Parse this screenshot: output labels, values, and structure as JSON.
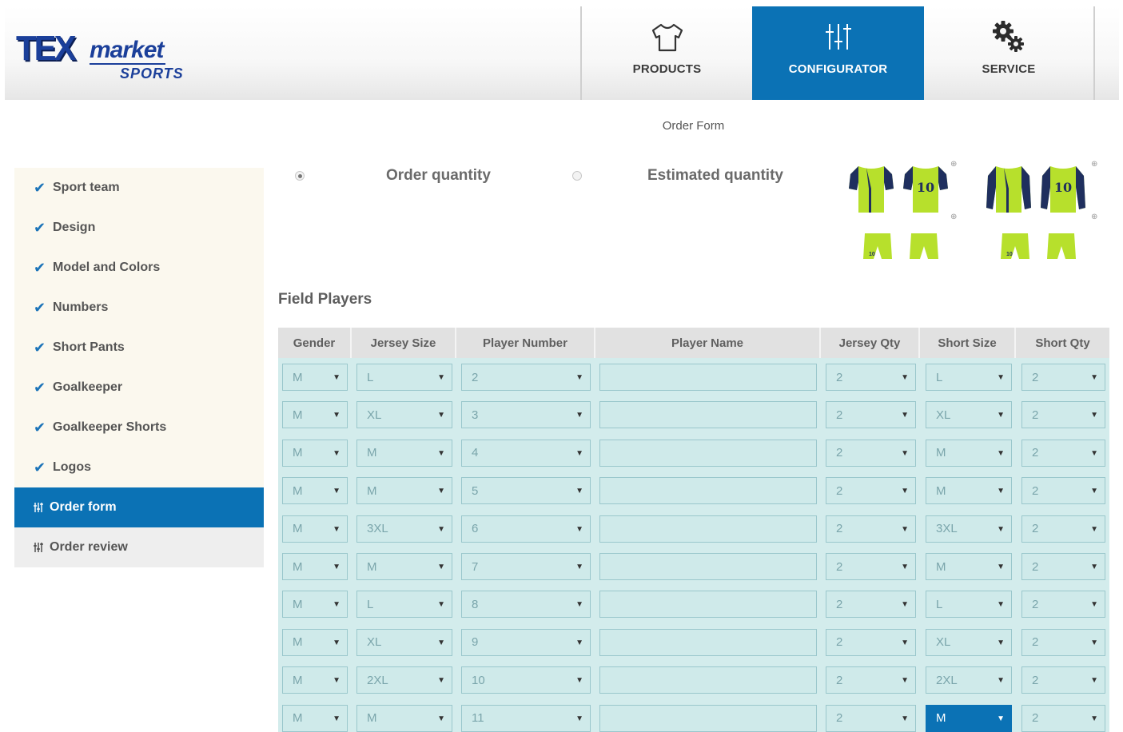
{
  "brand": {
    "logo_text": "TEXmarket SPORTS"
  },
  "nav": {
    "items": [
      {
        "label": "PRODUCTS",
        "icon": "tshirt-icon"
      },
      {
        "label": "CONFIGURATOR",
        "icon": "sliders-icon",
        "active": true
      },
      {
        "label": "SERVICE",
        "icon": "gears-icon"
      }
    ]
  },
  "page": {
    "title": "Order Form",
    "section": "Field Players"
  },
  "sidebar": {
    "items": [
      {
        "label": "Sport team",
        "done": true
      },
      {
        "label": "Design",
        "done": true
      },
      {
        "label": "Model and Colors",
        "done": true
      },
      {
        "label": "Numbers",
        "done": true
      },
      {
        "label": "Short Pants",
        "done": true
      },
      {
        "label": "Goalkeeper",
        "done": true
      },
      {
        "label": "Goalkeeper Shorts",
        "done": true
      },
      {
        "label": "Logos",
        "done": true
      },
      {
        "label": "Order form",
        "active": true
      },
      {
        "label": "Order review"
      }
    ]
  },
  "quantity": {
    "order_label": "Order quantity",
    "estimated_label": "Estimated quantity",
    "selected": "order"
  },
  "colors": {
    "accent": "#0b72b5",
    "jersey_green": "#b7e02c",
    "jersey_navy": "#1f2f5e",
    "table_bg": "#d3ecec"
  },
  "table": {
    "headers": [
      "Gender",
      "Jersey Size",
      "Player Number",
      "Player Name",
      "Jersey Qty",
      "Short Size",
      "Short Qty"
    ],
    "rows": [
      [
        "M",
        "L",
        "2",
        "",
        "2",
        "L",
        "2"
      ],
      [
        "M",
        "XL",
        "3",
        "",
        "2",
        "XL",
        "2"
      ],
      [
        "M",
        "M",
        "4",
        "",
        "2",
        "M",
        "2"
      ],
      [
        "M",
        "M",
        "5",
        "",
        "2",
        "M",
        "2"
      ],
      [
        "M",
        "3XL",
        "6",
        "",
        "2",
        "3XL",
        "2"
      ],
      [
        "M",
        "M",
        "7",
        "",
        "2",
        "M",
        "2"
      ],
      [
        "M",
        "L",
        "8",
        "",
        "2",
        "L",
        "2"
      ],
      [
        "M",
        "XL",
        "9",
        "",
        "2",
        "XL",
        "2"
      ],
      [
        "M",
        "2XL",
        "10",
        "",
        "2",
        "2XL",
        "2"
      ],
      [
        "M",
        "M",
        "11",
        "",
        "2",
        "M",
        "2"
      ]
    ]
  }
}
